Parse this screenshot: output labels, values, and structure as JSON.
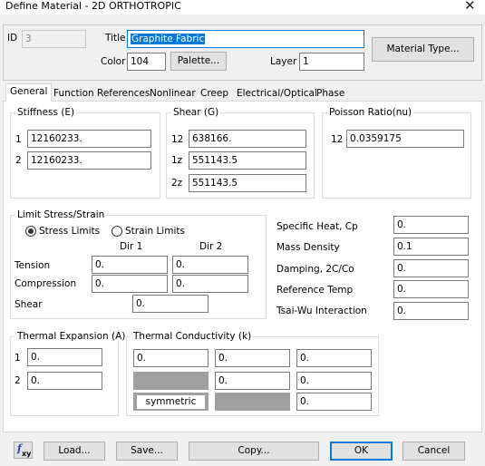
{
  "window": {
    "title": "Define Material - 2D ORTHOTROPIC",
    "close": "✕"
  },
  "header": {
    "id_label": "ID",
    "id_value": "3",
    "title_label": "Title",
    "title_value": "Graphite Fabric",
    "color_label": "Color",
    "color_value": "104",
    "palette_button": "Palette...",
    "layer_label": "Layer",
    "layer_value": "1",
    "material_type_button": "Material Type..."
  },
  "tabs": [
    "General",
    "Function References",
    "Nonlinear",
    "Creep",
    "Electrical/Optical",
    "Phase"
  ],
  "active_tab": "General",
  "stiffness": {
    "title": "Stiffness (E)",
    "rows": [
      {
        "label": "1",
        "value": "12160233."
      },
      {
        "label": "2",
        "value": "12160233."
      }
    ]
  },
  "shear": {
    "title": "Shear (G)",
    "rows": [
      {
        "label": "12",
        "value": "638166."
      },
      {
        "label": "1z",
        "value": "551143.5"
      },
      {
        "label": "2z",
        "value": "551143.5"
      }
    ]
  },
  "poisson": {
    "title": "Poisson Ratio(nu)",
    "label": "12",
    "value": "0.0359175"
  },
  "limit": {
    "title": "Limit Stress/Strain",
    "stress_limits": "Stress Limits",
    "strain_limits": "Strain Limits",
    "selected": "stress",
    "dir1": "Dir 1",
    "dir2": "Dir 2",
    "tension_label": "Tension",
    "tension_dir1": "0.",
    "tension_dir2": "0.",
    "compression_label": "Compression",
    "compression_dir1": "0.",
    "compression_dir2": "0.",
    "shear_label": "Shear",
    "shear_value": "0."
  },
  "properties": {
    "specific_heat_label": "Specific Heat, Cp",
    "specific_heat": "0.",
    "mass_density_label": "Mass Density",
    "mass_density": "0.1",
    "damping_label": "Damping, 2C/Co",
    "damping": "0.",
    "reference_temp_label": "Reference Temp",
    "reference_temp": "0.",
    "tsai_wu_label": "Tsai-Wu Interaction",
    "tsai_wu": "0."
  },
  "thermal_expansion": {
    "title": "Thermal Expansion (A)",
    "rows": [
      {
        "label": "1",
        "value": "0."
      },
      {
        "label": "2",
        "value": "0."
      }
    ]
  },
  "thermal_conductivity": {
    "title": "Thermal Conductivity (k)",
    "r1c1": "0.",
    "r1c2": "0.",
    "r1c3": "0.",
    "r2c2": "0.",
    "r2c3": "0.",
    "symmetric": "symmetric",
    "r3c3": "0."
  },
  "footer": {
    "fxy_icon": "function-xy-icon",
    "load_button": "Load...",
    "save_button": "Save...",
    "copy_button": "Copy...",
    "ok_button": "OK",
    "cancel_button": "Cancel"
  }
}
